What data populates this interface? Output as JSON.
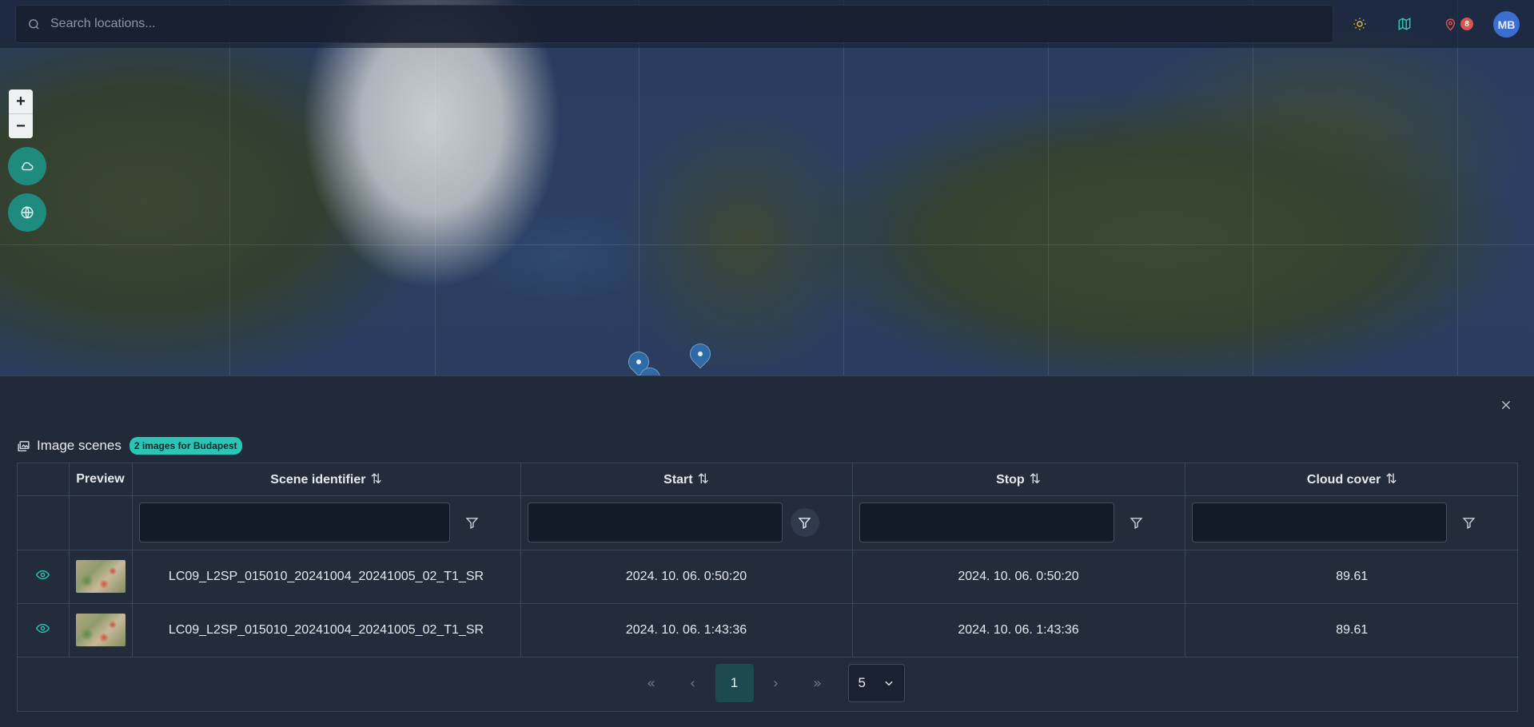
{
  "search": {
    "placeholder": "Search locations..."
  },
  "header": {
    "theme_icon": "sun-icon",
    "map_icon": "map-icon",
    "pin_icon": "map-pin-icon",
    "pin_count": "8",
    "avatar_initials": "MB"
  },
  "map_controls": {
    "zoom_in": "+",
    "zoom_out": "−"
  },
  "panel": {
    "title": "Image scenes",
    "badge": "2 images for Budapest",
    "columns": [
      "Preview",
      "Scene identifier",
      "Start",
      "Stop",
      "Cloud cover"
    ],
    "rows": [
      {
        "scene_id": "LC09_L2SP_015010_20241004_20241005_02_T1_SR",
        "start": "2024. 10. 06. 0:50:20",
        "stop": "2024. 10. 06. 0:50:20",
        "cloud_cover": "89.61"
      },
      {
        "scene_id": "LC09_L2SP_015010_20241004_20241005_02_T1_SR",
        "start": "2024. 10. 06. 1:43:36",
        "stop": "2024. 10. 06. 1:43:36",
        "cloud_cover": "89.61"
      }
    ],
    "pagination": {
      "first": "«",
      "prev": "‹",
      "current_page": "1",
      "next": "›",
      "last": "»",
      "rows_per_page": "5"
    }
  },
  "colors": {
    "accent": "#2bc4b5",
    "fab": "#1f8a7e",
    "avatar": "#3b6ed1",
    "badge": "#d9534f",
    "panel_bg": "#212a39"
  }
}
